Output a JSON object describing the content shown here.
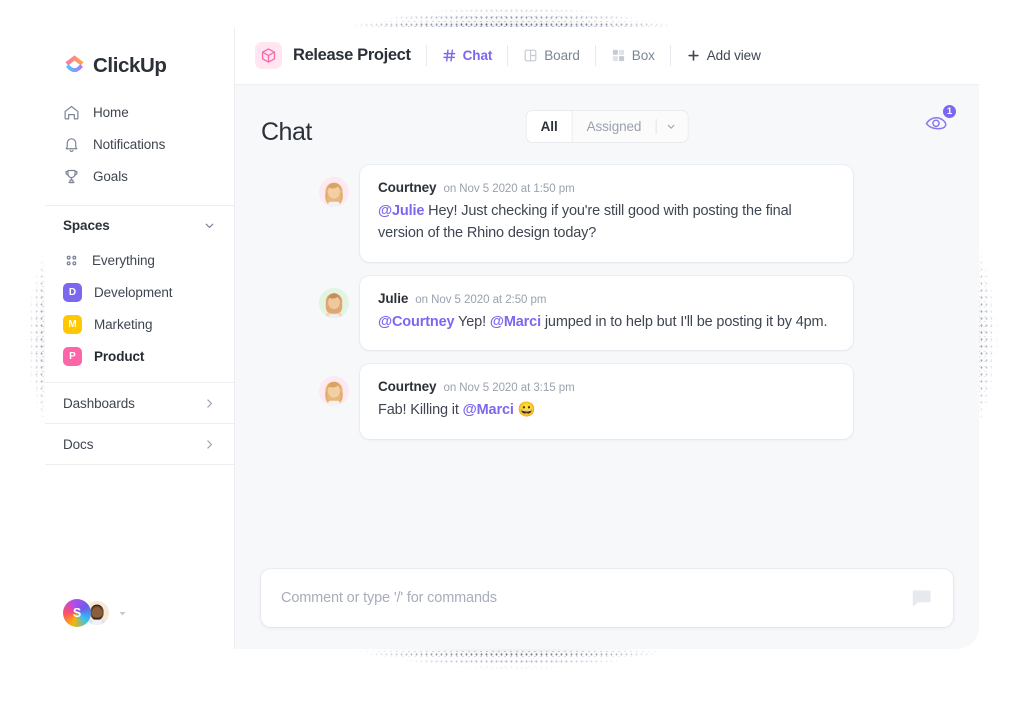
{
  "app": {
    "brand": "ClickUp",
    "logo_icon": "clickup-logo-icon"
  },
  "sidebar": {
    "nav": [
      {
        "label": "Home",
        "icon": "home-icon"
      },
      {
        "label": "Notifications",
        "icon": "bell-icon"
      },
      {
        "label": "Goals",
        "icon": "trophy-icon"
      }
    ],
    "spaces": {
      "title": "Spaces",
      "collapse_icon": "chevron-down-icon",
      "items": [
        {
          "label": "Everything",
          "icon": "grid-dots-icon",
          "badge": "",
          "color": "",
          "active": false
        },
        {
          "label": "Development",
          "icon": "space-badge",
          "badge": "D",
          "color": "#7b68ee",
          "active": false
        },
        {
          "label": "Marketing",
          "icon": "space-badge",
          "badge": "M",
          "color": "#ffc800",
          "active": false
        },
        {
          "label": "Product",
          "icon": "space-badge",
          "badge": "P",
          "color": "#fc65a8",
          "active": true
        }
      ]
    },
    "links": [
      {
        "label": "Dashboards",
        "icon": "chevron-right-icon"
      },
      {
        "label": "Docs",
        "icon": "chevron-right-icon"
      }
    ],
    "account": {
      "initial": "S",
      "avatar_icon": "user-avatar",
      "caret_icon": "caret-down-icon"
    }
  },
  "topbar": {
    "project_icon": "cube-icon",
    "project_title": "Release Project",
    "views": [
      {
        "label": "Chat",
        "icon": "hash-icon",
        "active": true
      },
      {
        "label": "Board",
        "icon": "board-icon",
        "active": false
      },
      {
        "label": "Box",
        "icon": "box-grid-icon",
        "active": false
      },
      {
        "label": "Add view",
        "icon": "plus-icon",
        "active": false
      }
    ]
  },
  "content": {
    "page_title": "Chat",
    "filter": {
      "all_label": "All",
      "assigned_label": "Assigned",
      "caret_icon": "chevron-down-icon",
      "selected": "All"
    },
    "watchers": {
      "icon": "eye-icon",
      "count": "1"
    }
  },
  "messages": [
    {
      "author": "Courtney",
      "time": "on Nov 5 2020 at 1:50 pm",
      "avatar": "courtney-avatar",
      "segments": [
        {
          "type": "mention",
          "text": "@Julie"
        },
        {
          "type": "text",
          "text": " Hey! Just checking if you're still good with posting the final version of the Rhino design today?"
        }
      ]
    },
    {
      "author": "Julie",
      "time": "on Nov 5 2020 at 2:50 pm",
      "avatar": "julie-avatar",
      "segments": [
        {
          "type": "mention",
          "text": "@Courtney"
        },
        {
          "type": "text",
          "text": " Yep! "
        },
        {
          "type": "mention",
          "text": "@Marci"
        },
        {
          "type": "text",
          "text": " jumped in to help but I'll be posting it by 4pm."
        }
      ]
    },
    {
      "author": "Courtney",
      "time": "on Nov 5 2020 at 3:15 pm",
      "avatar": "courtney-avatar",
      "segments": [
        {
          "type": "text",
          "text": "Fab! Killing it "
        },
        {
          "type": "mention",
          "text": "@Marci"
        },
        {
          "type": "text",
          "text": " 😀"
        }
      ]
    }
  ],
  "composer": {
    "placeholder": "Comment or type '/' for commands",
    "icon": "comment-bubble-icon"
  },
  "colors": {
    "accent": "#7b68ee",
    "pink": "#fc65a8",
    "yellow": "#ffc800",
    "canvas": "#f7f8fa",
    "text": "#3f4651"
  }
}
